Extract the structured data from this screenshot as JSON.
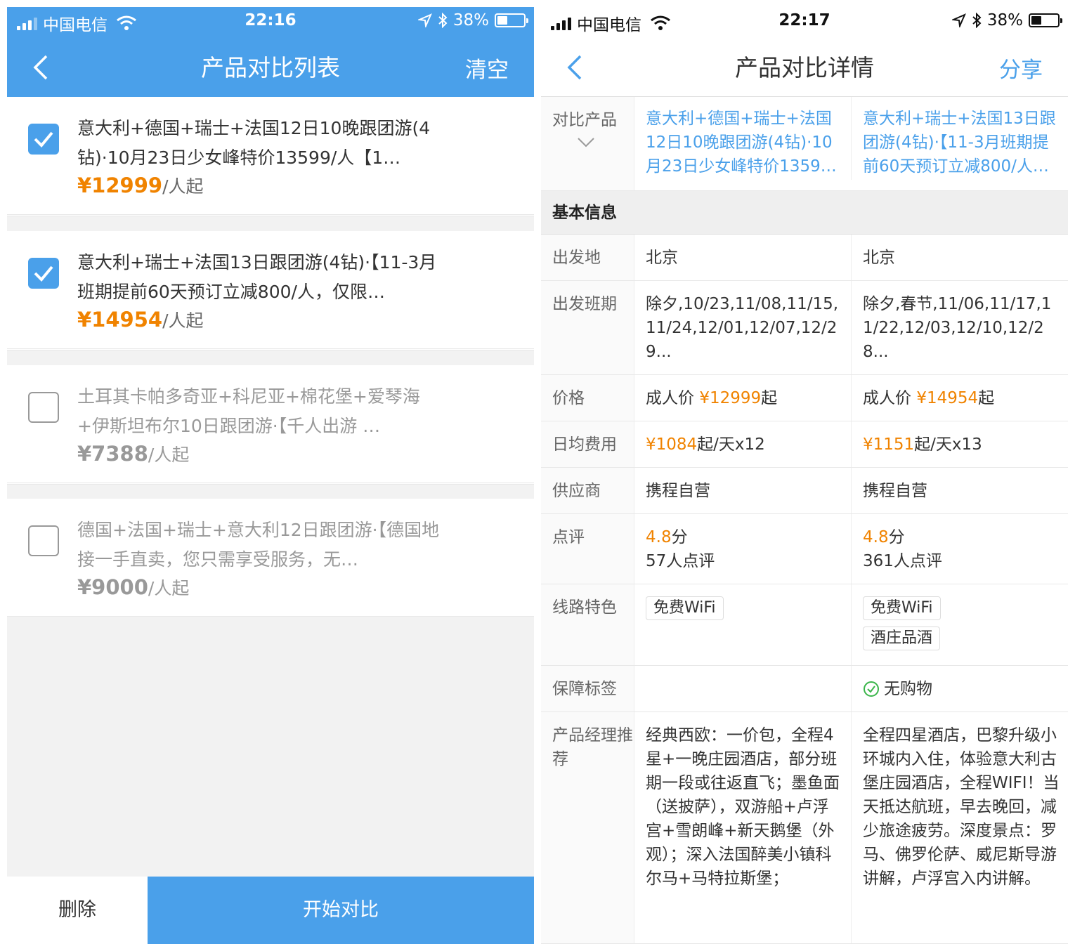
{
  "left": {
    "status": {
      "carrier": "中国电信",
      "time": "22:16",
      "battery": "38%"
    },
    "header": {
      "title": "产品对比列表",
      "action": "清空"
    },
    "items": [
      {
        "title": "意大利+德国+瑞士+法国12日10晚跟团游(4钻)·10月23日少女峰特价13599/人【1…",
        "price": "¥12999",
        "unit": "/人起",
        "checked": true
      },
      {
        "title": "意大利+瑞士+法国13日跟团游(4钻)·【11-3月班期提前60天预订立减800/人，仅限…",
        "price": "¥14954",
        "unit": "/人起",
        "checked": true
      },
      {
        "title": "土耳其卡帕多奇亚+科尼亚+棉花堡+爱琴海+伊斯坦布尔10日跟团游·【千人出游 …",
        "price": "¥7388",
        "unit": "/人起",
        "checked": false
      },
      {
        "title": "德国+法国+瑞士+意大利12日跟团游·【德国地接一手直卖，您只需享受服务，无…",
        "price": "¥9000",
        "unit": "/人起",
        "checked": false
      }
    ],
    "bottom": {
      "delete": "删除",
      "compare": "开始对比"
    }
  },
  "right": {
    "status": {
      "carrier": "中国电信",
      "time": "22:17",
      "battery": "38%"
    },
    "header": {
      "title": "产品对比详情",
      "action": "分享"
    },
    "products_label": "对比产品",
    "products": [
      "意大利+德国+瑞士+法国12日10晚跟团游(4钻)·10月23日少女峰特价1359…",
      "意大利+瑞士+法国13日跟团游(4钻)·【11-3月班期提前60天预订立减800/人…"
    ],
    "section": "基本信息",
    "rows": {
      "depart": {
        "label": "出发地",
        "v1": "北京",
        "v2": "北京"
      },
      "dates": {
        "label": "出发班期",
        "v1": "除夕,10/23,11/08,11/15,11/24,12/01,12/07,12/29...",
        "v2": "除夕,春节,11/06,11/17,11/22,12/03,12/10,12/28..."
      },
      "price": {
        "label": "价格",
        "prefix": "成人价 ",
        "p1": "¥12999",
        "p2": "¥14954",
        "suffix": "起"
      },
      "daily": {
        "label": "日均费用",
        "d1": "¥1084",
        "s1": "起/天x12",
        "d2": "¥1151",
        "s2": "起/天x13"
      },
      "supplier": {
        "label": "供应商",
        "v1": "携程自营",
        "v2": "携程自营"
      },
      "review": {
        "label": "点评",
        "score1": "4.8",
        "cnt1": "57人点评",
        "score2": "4.8",
        "cnt2": "361人点评",
        "unit": "分"
      },
      "features": {
        "label": "线路特色",
        "t1": "免费WiFi",
        "t2a": "免费WiFi",
        "t2b": "酒庄品酒"
      },
      "guarantee": {
        "label": "保障标签",
        "v2": "无购物"
      },
      "manager": {
        "label": "产品经理推荐",
        "v1": "经典西欧：一价包，全程4星+一晚庄园酒店，部分班期一段或往返直飞；墨鱼面（送披萨），双游船+卢浮宫+雪朗峰+新天鹅堡（外观）；深入法国醉美小镇科尔马+马特拉斯堡；",
        "v2": "全程四星酒店，巴黎升级小环城内入住，体验意大利古堡庄园酒店，全程WIFI！当天抵达航班，早去晚回，减少旅途疲劳。深度景点：罗马、佛罗伦萨、威尼斯导游讲解，卢浮宫入内讲解。"
      }
    }
  },
  "colors": {
    "primary": "#4aa0ea",
    "price": "#f08300"
  }
}
